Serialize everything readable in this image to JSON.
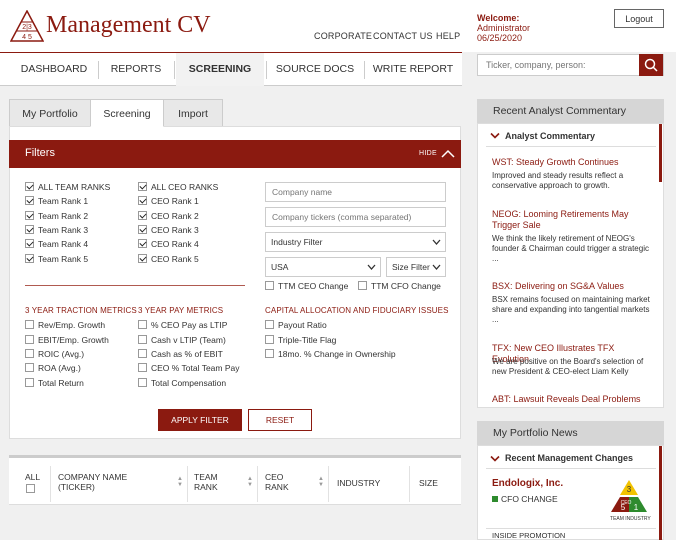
{
  "header": {
    "logo_text": "Management CV",
    "logo_badge_top": "2|3",
    "logo_badge_bottom": "4 5",
    "nav_links": [
      "CORPORATE",
      "CONTACT US",
      "HELP"
    ],
    "welcome_label": "Welcome:",
    "user_name": "Administrator",
    "date": "06/25/2020",
    "logout_label": "Logout"
  },
  "main_nav": {
    "items": [
      "DASHBOARD",
      "REPORTS",
      "SCREENING",
      "SOURCE DOCS",
      "WRITE REPORT"
    ],
    "active": "SCREENING"
  },
  "search": {
    "placeholder": "Ticker, company, person:"
  },
  "subtabs": {
    "items": [
      "My Portfolio",
      "Screening",
      "Import"
    ],
    "active": "Screening"
  },
  "filters": {
    "title": "Filters",
    "hide_label": "HIDE",
    "team_ranks": [
      {
        "label": "ALL TEAM RANKS",
        "checked": true
      },
      {
        "label": "Team Rank 1",
        "checked": true
      },
      {
        "label": "Team Rank 2",
        "checked": true
      },
      {
        "label": "Team Rank 3",
        "checked": true
      },
      {
        "label": "Team Rank 4",
        "checked": true
      },
      {
        "label": "Team Rank 5",
        "checked": true
      }
    ],
    "ceo_ranks": [
      {
        "label": "ALL CEO RANKS",
        "checked": true
      },
      {
        "label": "CEO Rank 1",
        "checked": true
      },
      {
        "label": "CEO Rank 2",
        "checked": true
      },
      {
        "label": "CEO Rank 3",
        "checked": true
      },
      {
        "label": "CEO Rank 4",
        "checked": true
      },
      {
        "label": "CEO Rank 5",
        "checked": true
      }
    ],
    "company_name_placeholder": "Company name",
    "company_tickers_placeholder": "Company tickers (comma separated)",
    "industry_filter": "Industry Filter",
    "country": "USA",
    "size_filter": "Size Filter",
    "ttm_ceo_change": "TTM CEO Change",
    "ttm_cfo_change": "TTM CFO Change",
    "traction_title": "3 YEAR TRACTION METRICS",
    "traction": [
      "Rev/Emp. Growth",
      "EBIT/Emp. Growth",
      "ROIC (Avg.)",
      "ROA (Avg.)",
      "Total Return"
    ],
    "pay_title": "3 YEAR PAY METRICS",
    "pay": [
      "% CEO Pay as LTIP",
      "Cash v LTIP (Team)",
      "Cash as % of EBIT",
      "CEO % Total Team Pay",
      "Total Compensation"
    ],
    "capital_title": "CAPITAL ALLOCATION AND FIDUCIARY ISSUES",
    "capital": [
      "Payout Ratio",
      "Triple-Title Flag",
      "18mo. % Change in Ownership"
    ],
    "apply_label": "APPLY FILTER",
    "reset_label": "RESET"
  },
  "table": {
    "all_label": "ALL",
    "company_name": "COMPANY NAME",
    "ticker": "(TICKER)",
    "team": "TEAM",
    "team_rank": "RANK",
    "ceo": "CEO",
    "ceo_rank": "RANK",
    "industry": "INDUSTRY",
    "size": "SIZE"
  },
  "commentary": {
    "header": "Recent Analyst Commentary",
    "sub": "Analyst Commentary",
    "items": [
      {
        "title": "WST: Steady Growth Continues",
        "body": "Improved and steady results reflect a conservative approach to growth."
      },
      {
        "title": "NEOG: Looming Retirements May Trigger Sale",
        "body": "We think the likely retirement of NEOG's founder & Chairman could trigger a strategic ..."
      },
      {
        "title": "BSX: Delivering on SG&A Values",
        "body": "BSX remains focused on maintaining market share and expanding into tangential markets ..."
      },
      {
        "title": "TFX: New CEO Illustrates TFX Evolution",
        "body": "We are positive on the Board's selection of new President & CEO-elect Liam Kelly"
      },
      {
        "title": "ABT: Lawsuit Reveals Deal Problems",
        "body": ""
      }
    ]
  },
  "portfolio_news": {
    "header": "My Portfolio News",
    "sub": "Recent Management Changes",
    "company": "Endologix, Inc.",
    "change": "CFO CHANGE",
    "next": "INSIDE PROMOTION",
    "badge_top": "3",
    "badge_left": "5",
    "badge_right": "1",
    "badge_mid": "CEO",
    "badge_team": "TEAM",
    "badge_industry": "INDUSTRY"
  },
  "colors": {
    "brand": "#8b1a10",
    "green": "#2e8b2e",
    "yellow": "#f2c300"
  }
}
